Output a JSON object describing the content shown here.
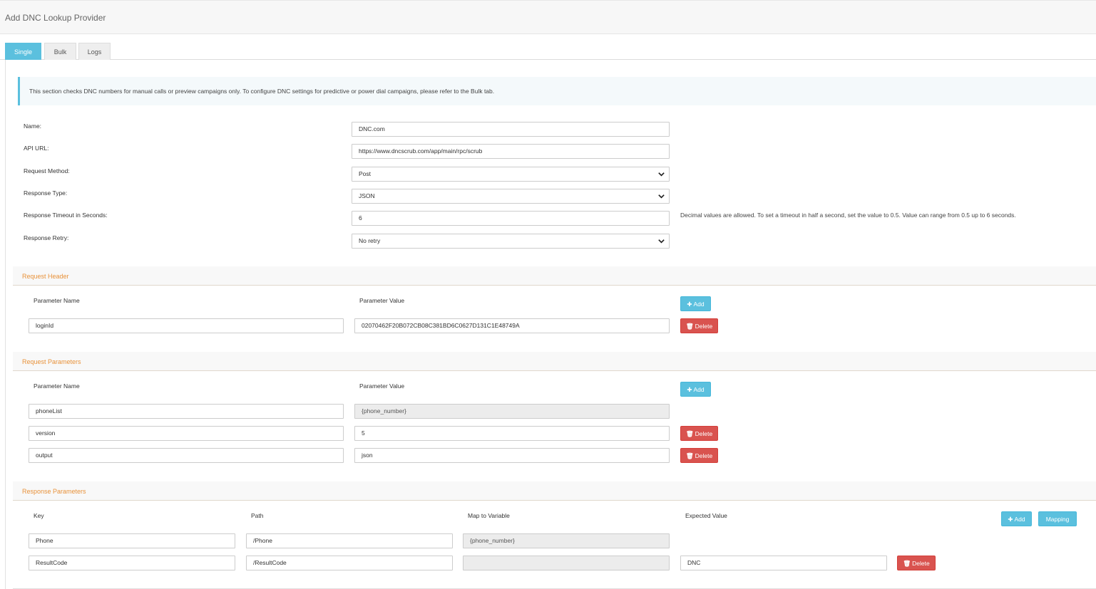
{
  "page": {
    "title": "Add DNC Lookup Provider"
  },
  "tabs": [
    {
      "label": "Single",
      "active": true
    },
    {
      "label": "Bulk",
      "active": false
    },
    {
      "label": "Logs",
      "active": false
    }
  ],
  "info": {
    "text": "This section checks DNC numbers for manual calls or preview campaigns only. To configure DNC settings for predictive or power dial campaigns, please refer to the Bulk tab."
  },
  "form": {
    "name": {
      "label": "Name:",
      "value": "DNC.com"
    },
    "api_url": {
      "label": "API URL:",
      "value": "https://www.dncscrub.com/app/main/rpc/scrub"
    },
    "request_method": {
      "label": "Request Method:",
      "value": "Post"
    },
    "response_type": {
      "label": "Response Type:",
      "value": "JSON"
    },
    "timeout": {
      "label": "Response Timeout in Seconds:",
      "value": "6",
      "hint": "Decimal values are allowed. To set a timeout in half a second, set the value to 0.5. Value can range from 0.5 up to 6 seconds."
    },
    "retry": {
      "label": "Response Retry:",
      "value": "No retry"
    }
  },
  "request_header": {
    "title": "Request Header",
    "col_name": "Parameter Name",
    "col_value": "Parameter Value",
    "add_label": "Add",
    "rows": [
      {
        "name": "loginId",
        "value": "02070462F20B072CB08C381BD6C0627D131C1E48749A",
        "delete_label": "Delete"
      }
    ]
  },
  "request_params": {
    "title": "Request Parameters",
    "col_name": "Parameter Name",
    "col_value": "Parameter Value",
    "add_label": "Add",
    "rows": [
      {
        "name": "phoneList",
        "value": "{phone_number}"
      },
      {
        "name": "version",
        "value": "5",
        "delete_label": "Delete"
      },
      {
        "name": "output",
        "value": "json",
        "delete_label": "Delete"
      }
    ]
  },
  "response_params": {
    "title": "Response Parameters",
    "col_key": "Key",
    "col_path": "Path",
    "col_map": "Map to Variable",
    "col_expected": "Expected Value",
    "add_label": "Add",
    "mapping_label": "Mapping",
    "rows": [
      {
        "key": "Phone",
        "path": "/Phone",
        "map": "{phone_number}",
        "expected": ""
      },
      {
        "key": "ResultCode",
        "path": "/ResultCode",
        "map": "",
        "expected": "DNC",
        "delete_label": "Delete"
      }
    ]
  },
  "colors": {
    "info": "#5bc0de",
    "danger": "#d9534f",
    "section_title": "#e8923a"
  }
}
